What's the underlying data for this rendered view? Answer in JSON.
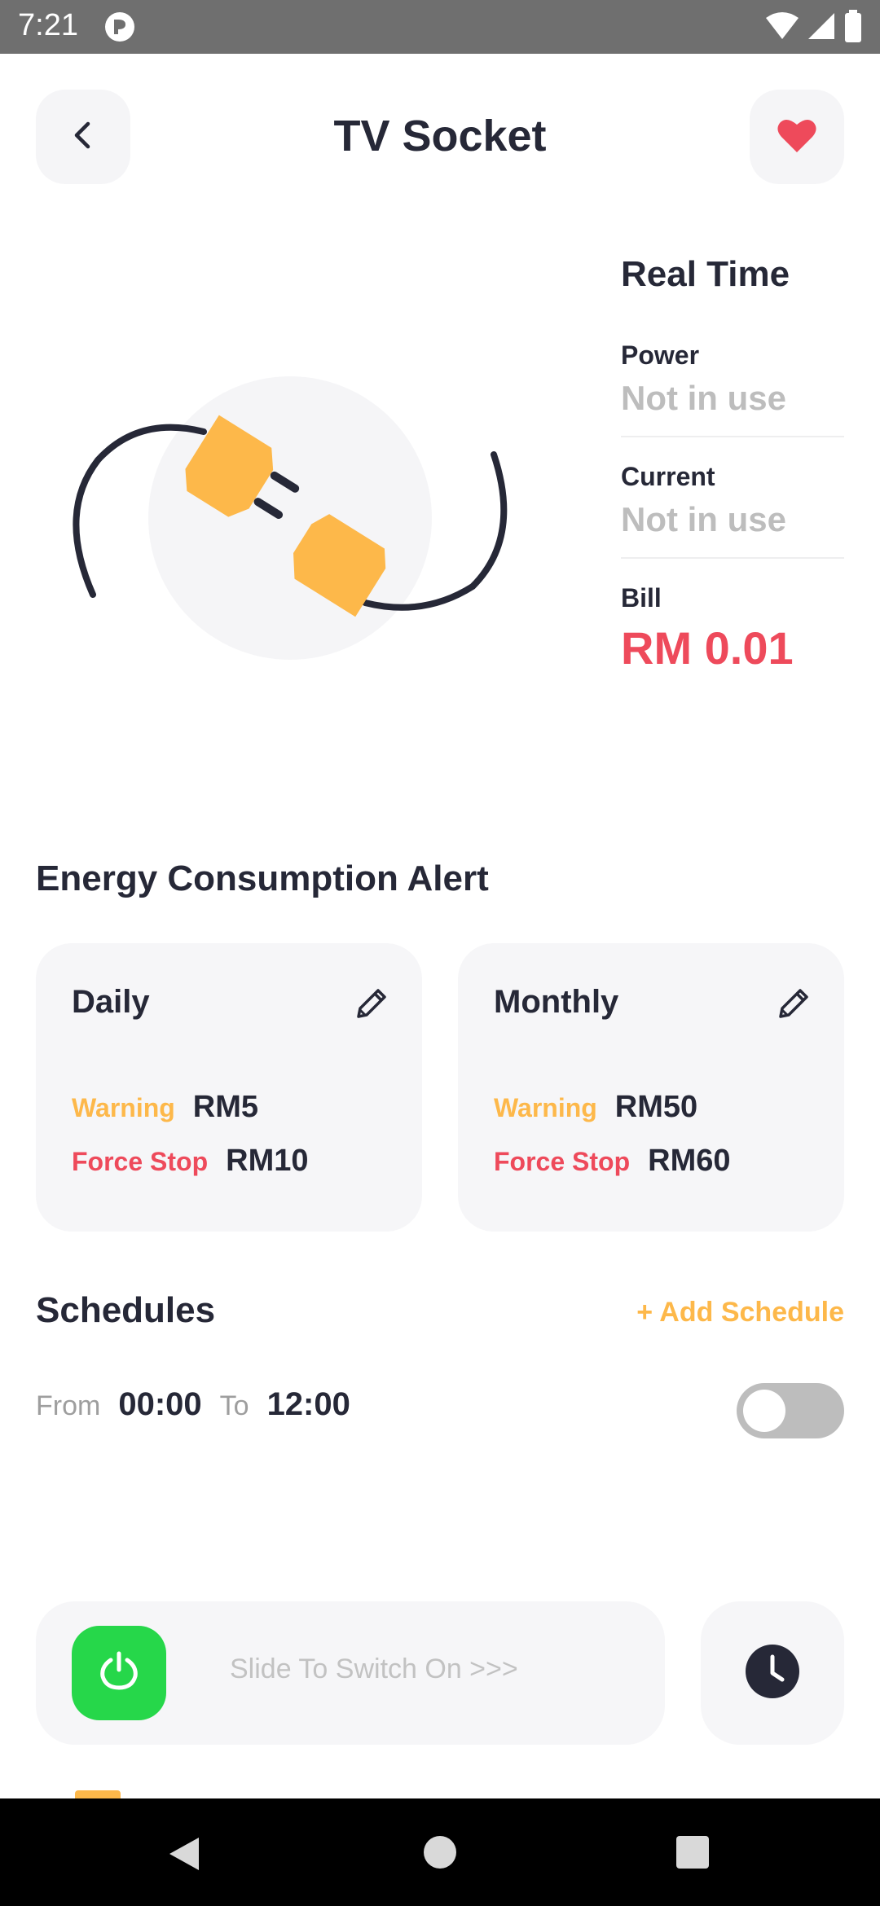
{
  "status_bar": {
    "time": "7:21",
    "icons": [
      "app-notification-icon",
      "wifi-icon",
      "signal-icon",
      "battery-icon"
    ]
  },
  "header": {
    "title": "TV Socket",
    "back_icon": "chevron-left-icon",
    "favorite_icon": "heart-icon",
    "favorite_color": "#ee4a5b"
  },
  "illustration": {
    "icon": "unplugged-socket-illustration"
  },
  "realtime": {
    "title": "Real Time",
    "power_label": "Power",
    "power_value": "Not in use",
    "current_label": "Current",
    "current_value": "Not in use",
    "bill_label": "Bill",
    "bill_value": "RM 0.01"
  },
  "energy_alert": {
    "title": "Energy Consumption Alert",
    "cards": [
      {
        "title": "Daily",
        "warning_label": "Warning",
        "warning_value": "RM5",
        "force_stop_label": "Force Stop",
        "force_stop_value": "RM10"
      },
      {
        "title": "Monthly",
        "warning_label": "Warning",
        "warning_value": "RM50",
        "force_stop_label": "Force Stop",
        "force_stop_value": "RM60"
      }
    ]
  },
  "schedules": {
    "title": "Schedules",
    "add_label": "+ Add Schedule",
    "items": [
      {
        "from_label": "From",
        "from_value": "00:00",
        "to_label": "To",
        "to_value": "12:00",
        "enabled": false
      }
    ]
  },
  "controls": {
    "slider_text": "Slide To Switch On >>>",
    "power_icon": "power-icon",
    "timer_icon": "clock-icon"
  },
  "colors": {
    "accent_orange": "#fdb84a",
    "alert_red": "#ee4a5b",
    "power_green": "#26d74a",
    "dark_text": "#262837",
    "card_bg": "#f6f6f8"
  }
}
